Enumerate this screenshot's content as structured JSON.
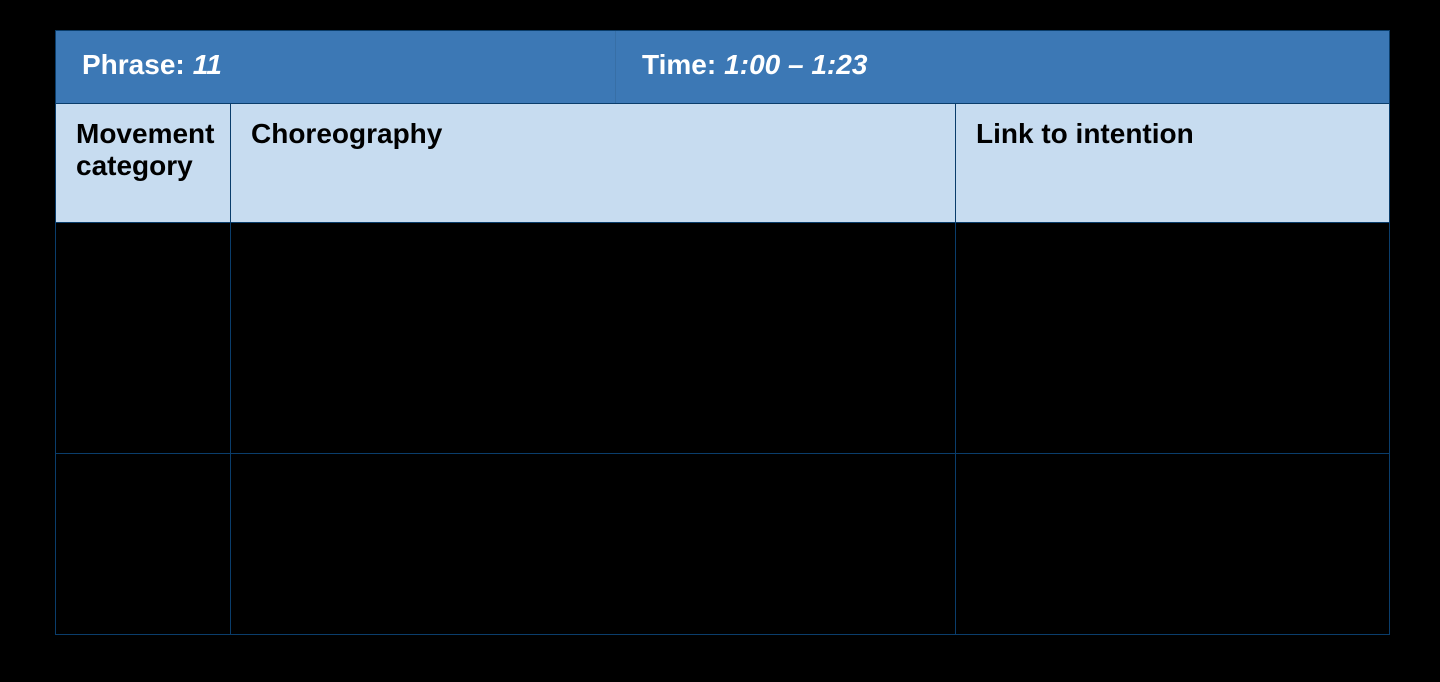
{
  "header": {
    "phrase_label": "Phrase:",
    "phrase_value": "11",
    "time_label": "Time:",
    "time_value": "1:00 – 1:23"
  },
  "columns": {
    "col1": "Movement category",
    "col2": "Choreography",
    "col3": "Link to intention"
  },
  "rows": [
    {
      "movement_category": "",
      "choreography": "",
      "link_to_intention": ""
    },
    {
      "movement_category": "",
      "choreography": "",
      "link_to_intention": ""
    }
  ]
}
